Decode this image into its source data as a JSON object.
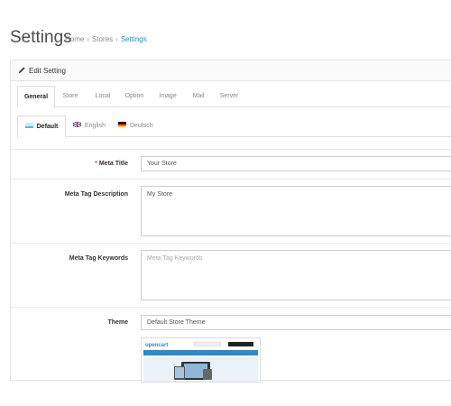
{
  "header": {
    "title": "Settings",
    "breadcrumb": [
      "Home",
      "Stores",
      "Settings"
    ]
  },
  "panel": {
    "title": "Edit Setting",
    "tabs": [
      "General",
      "Store",
      "Local",
      "Option",
      "Image",
      "Mail",
      "Server"
    ],
    "active_tab": "General",
    "language_tabs": [
      "Default",
      "English",
      "Deutsch"
    ],
    "active_language_tab": "Default"
  },
  "form": {
    "meta_title": {
      "label": "Meta Title",
      "required": "*",
      "value": "Your Store"
    },
    "meta_description": {
      "label": "Meta Tag Description",
      "value": "My Store"
    },
    "meta_keywords": {
      "label": "Meta Tag Keywords",
      "value": "",
      "placeholder": "Meta Tag Keywords"
    },
    "theme": {
      "label": "Theme",
      "value": "Default Store Theme"
    }
  },
  "theme_preview": {
    "logo_text": "opencart"
  },
  "colors": {
    "accent": "#1e91cf",
    "required": "#e3503e",
    "border": "#dddddd"
  },
  "icons": {
    "edit": "pencil-icon",
    "flag_en": "uk-flag-icon",
    "flag_de": "german-flag-icon",
    "flag_default": "default-flag-icon"
  }
}
